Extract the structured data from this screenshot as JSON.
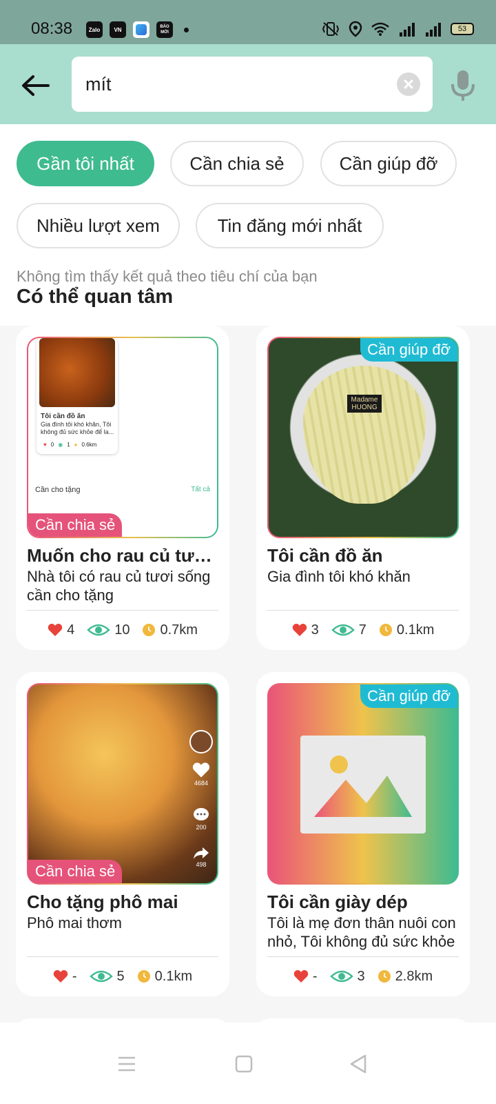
{
  "status_bar": {
    "time": "08:38",
    "app_icons": [
      "Zalo",
      "VN",
      "blue-app",
      "BÁO MỚI"
    ],
    "battery": "53"
  },
  "search": {
    "value": "mít",
    "back_icon": "arrow-left-icon",
    "clear_icon": "close-circle-icon",
    "mic_icon": "microphone-icon"
  },
  "filters": [
    {
      "label": "Gần tôi nhất",
      "active": true
    },
    {
      "label": "Cần chia sẻ",
      "active": false
    },
    {
      "label": "Cần giúp đỡ",
      "active": false
    },
    {
      "label": "Nhiều lượt xem",
      "active": false
    },
    {
      "label": "Tin đăng mới nhất",
      "active": false
    }
  ],
  "no_result_text": "Không tìm thấy kết quả theo tiêu chí của bạn",
  "section_title": "Có thể quan tâm",
  "cards": [
    {
      "tag": "Cần chia sẻ",
      "title": "Muốn cho rau củ tươ...",
      "desc": "Nhà tôi có rau củ tươi sống cần cho tặng",
      "likes": "4",
      "views": "10",
      "distance": "0.7km",
      "image_text": {
        "title": "Tôi cần đồ ăn",
        "body": "Gia đình tôi khó khăn, Tôi không đủ sức khỏe để la...",
        "likes": "0",
        "views": "1",
        "distance": "0.6km",
        "section": "Cần cho tặng",
        "see_all": "Tất cả"
      }
    },
    {
      "tag": "Cần giúp đỡ",
      "title": "Tôi cần đồ ăn",
      "desc": "Gia đình tôi khó khăn",
      "likes": "3",
      "views": "7",
      "distance": "0.1km",
      "image_text": {
        "logo": "Madame HUONG"
      }
    },
    {
      "tag": "Cần chia sẻ",
      "title": "Cho tặng phô mai",
      "desc": "Phô mai thơm",
      "likes": "-",
      "views": "5",
      "distance": "0.1km",
      "image_text": {
        "like_count": "4684",
        "comment_count": "200",
        "share_count": "498"
      }
    },
    {
      "tag": "Cần giúp đỡ",
      "title": "Tôi cần giày dép",
      "desc": "Tôi là mẹ đơn thân nuôi con nhỏ, Tôi không đủ sức khỏe",
      "likes": "-",
      "views": "3",
      "distance": "2.8km"
    }
  ],
  "colors": {
    "header_bg": "#a9ddcd",
    "accent_green": "#3fbb90",
    "tag_share": "#e5537a",
    "tag_help": "#1fbbd3",
    "heart": "#e8433a",
    "eye": "#3fbb90",
    "distance": "#f0b83c"
  },
  "nav": {
    "menu_icon": "menu-icon",
    "home_icon": "square-home-icon",
    "back_icon": "triangle-back-icon"
  }
}
